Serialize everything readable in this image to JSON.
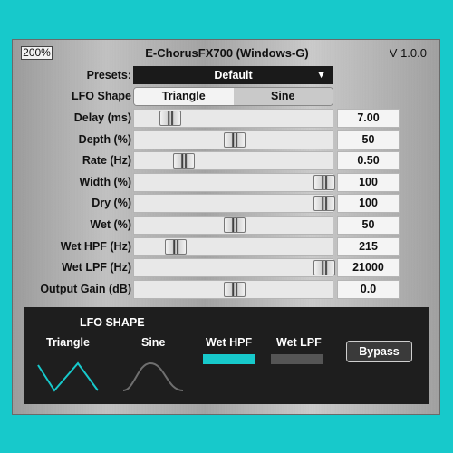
{
  "header": {
    "zoom": "200%",
    "title": "E-ChorusFX700 (Windows-G)",
    "version": "V 1.0.0"
  },
  "presets": {
    "label": "Presets:",
    "value": "Default",
    "arrow": "▼"
  },
  "lfo_shape": {
    "label": "LFO Shape",
    "options": [
      "Triangle",
      "Sine"
    ],
    "selected": "Triangle"
  },
  "params": [
    {
      "label": "Delay (ms)",
      "value": "7.00",
      "level": 0.18
    },
    {
      "label": "Depth (%)",
      "value": "50",
      "level": 0.5
    },
    {
      "label": "Rate (Hz)",
      "value": "0.50",
      "level": 0.25
    },
    {
      "label": "Width (%)",
      "value": "100",
      "level": 0.95
    },
    {
      "label": "Dry (%)",
      "value": "100",
      "level": 0.95
    },
    {
      "label": "Wet (%)",
      "value": "50",
      "level": 0.5
    },
    {
      "label": "Wet HPF (Hz)",
      "value": "215",
      "level": 0.21
    },
    {
      "label": "Wet LPF (Hz)",
      "value": "21000",
      "level": 0.95
    },
    {
      "label": "Output Gain (dB)",
      "value": "0.0",
      "level": 0.5
    }
  ],
  "bottom": {
    "heading": "LFO SHAPE",
    "triangle_label": "Triangle",
    "sine_label": "Sine",
    "wet_hpf_label": "Wet HPF",
    "wet_lpf_label": "Wet LPF",
    "bypass_label": "Bypass",
    "icons": [
      "triangle-wave-icon",
      "sine-wave-icon"
    ],
    "colors": {
      "accent": "#17c9cb",
      "inactive": "#555555",
      "panel": "#1e1e1e",
      "background": "#17c9cb"
    }
  }
}
